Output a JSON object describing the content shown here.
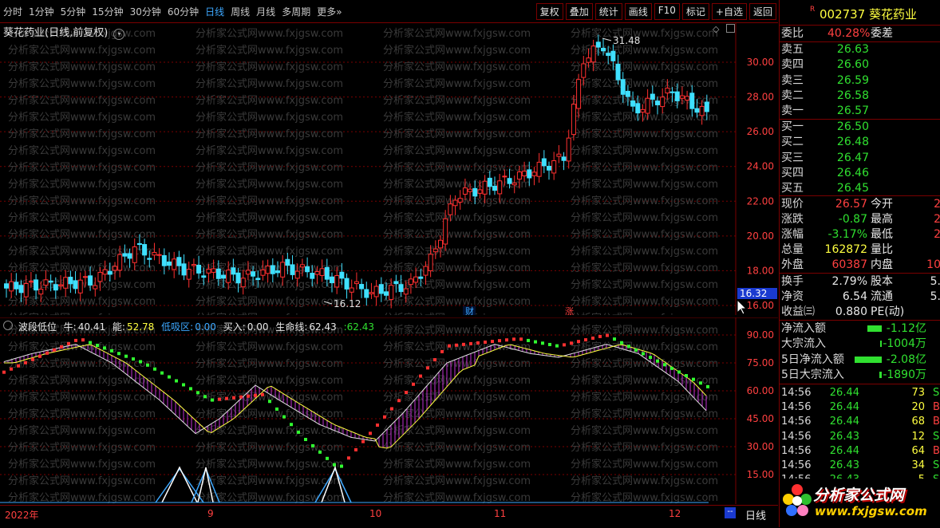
{
  "toolbar": {
    "timeframes": [
      "分时",
      "1分钟",
      "5分钟",
      "15分钟",
      "30分钟",
      "60分钟",
      "日线",
      "周线",
      "月线",
      "多周期",
      "更多»"
    ],
    "active_timeframe": "日线",
    "tools": [
      "复权",
      "叠加",
      "统计",
      "画线",
      "F10",
      "标记",
      "+自选",
      "返回"
    ]
  },
  "chart": {
    "title": "葵花药业(日线,前复权)",
    "price_axis": [
      "30.00",
      "28.00",
      "26.00",
      "24.00",
      "22.00",
      "20.00",
      "18.00",
      "16.00"
    ],
    "current_price_tag": "16.32",
    "high_label": "31.48",
    "low_label": "16.12",
    "marker_cai": "财",
    "marker_zhang": "涨",
    "watermark": "分析家公式网www.fxjgsw.com",
    "colors": {
      "up": "#ff3030",
      "down": "#3fe0ff",
      "grid": "#7a0000",
      "axis": "#ff4040"
    }
  },
  "indicator": {
    "name": "波段低位",
    "niu_label": "牛:",
    "niu_value": "40.41",
    "neng_label": "能:",
    "neng_value": "52.78",
    "dixi_label": "低吸区:",
    "dixi_value": "0.00",
    "buy_label": "买入:",
    "buy_value": "0.00",
    "life_label": "生命线:",
    "life_value": "62.43",
    "life_value2": ":62.43",
    "axis": [
      "90.00",
      "75.00",
      "60.00",
      "45.00",
      "30.00",
      "15.00"
    ]
  },
  "date_axis": {
    "labels": [
      "2022年",
      "9",
      "10",
      "11",
      "12"
    ],
    "period": "日线",
    "scroll": "--"
  },
  "panel": {
    "flag": "R",
    "code": "002737",
    "name": "葵花药业",
    "weibi_label": "委比",
    "weibi": "40.28%",
    "weicha_label": "委差",
    "asks": [
      {
        "label": "卖五",
        "price": "26.63"
      },
      {
        "label": "卖四",
        "price": "26.60"
      },
      {
        "label": "卖三",
        "price": "26.59"
      },
      {
        "label": "卖二",
        "price": "26.58"
      },
      {
        "label": "卖一",
        "price": "26.57"
      }
    ],
    "bids": [
      {
        "label": "买一",
        "price": "26.50"
      },
      {
        "label": "买二",
        "price": "26.48"
      },
      {
        "label": "买三",
        "price": "26.47"
      },
      {
        "label": "买四",
        "price": "26.46"
      },
      {
        "label": "买五",
        "price": "26.45"
      }
    ],
    "quote": [
      {
        "l1": "现价",
        "v1": "26.57",
        "c1": "red",
        "l2": "今开",
        "v2": "2"
      },
      {
        "l1": "涨跌",
        "v1": "-0.87",
        "c1": "green",
        "l2": "最高",
        "v2": "2"
      },
      {
        "l1": "涨幅",
        "v1": "-3.17%",
        "c1": "green",
        "l2": "最低",
        "v2": "2"
      },
      {
        "l1": "总量",
        "v1": "162872",
        "c1": "yellow",
        "l2": "量比",
        "v2": ""
      },
      {
        "l1": "外盘",
        "v1": "60387",
        "c1": "red",
        "l2": "内盘",
        "v2": "10"
      }
    ],
    "fund": [
      {
        "l1": "换手",
        "v1": "2.79%",
        "l2": "股本",
        "v2": "5."
      },
      {
        "l1": "净资",
        "v1": "6.54",
        "l2": "流通",
        "v2": "5."
      },
      {
        "l1": "收益㈢",
        "v1": "0.880",
        "l2": "PE(动)",
        "v2": ""
      }
    ],
    "flows": [
      {
        "label": "净流入额",
        "value": "-1.12亿",
        "bar": 18
      },
      {
        "label": "大宗流入",
        "value": "-1004万",
        "bar": 2
      },
      {
        "label": "5日净流入额",
        "value": "-2.08亿",
        "bar": 34
      },
      {
        "label": "5日大宗流入",
        "value": "-1890万",
        "bar": 3
      }
    ],
    "ticks": [
      {
        "time": "14:56",
        "price": "26.44",
        "vol": "73",
        "side": "S"
      },
      {
        "time": "14:56",
        "price": "26.44",
        "vol": "20",
        "side": "B"
      },
      {
        "time": "14:56",
        "price": "26.44",
        "vol": "68",
        "side": "B"
      },
      {
        "time": "14:56",
        "price": "26.43",
        "vol": "12",
        "side": "S"
      },
      {
        "time": "14:56",
        "price": "26.44",
        "vol": "64",
        "side": "B"
      },
      {
        "time": "14:56",
        "price": "26.43",
        "vol": "34",
        "side": "S"
      },
      {
        "time": "14:56",
        "price": "26.43",
        "vol": "5",
        "side": "S"
      }
    ],
    "logo_text": "分析家公式网",
    "logo_url": "www.fxjgsw.com"
  }
}
